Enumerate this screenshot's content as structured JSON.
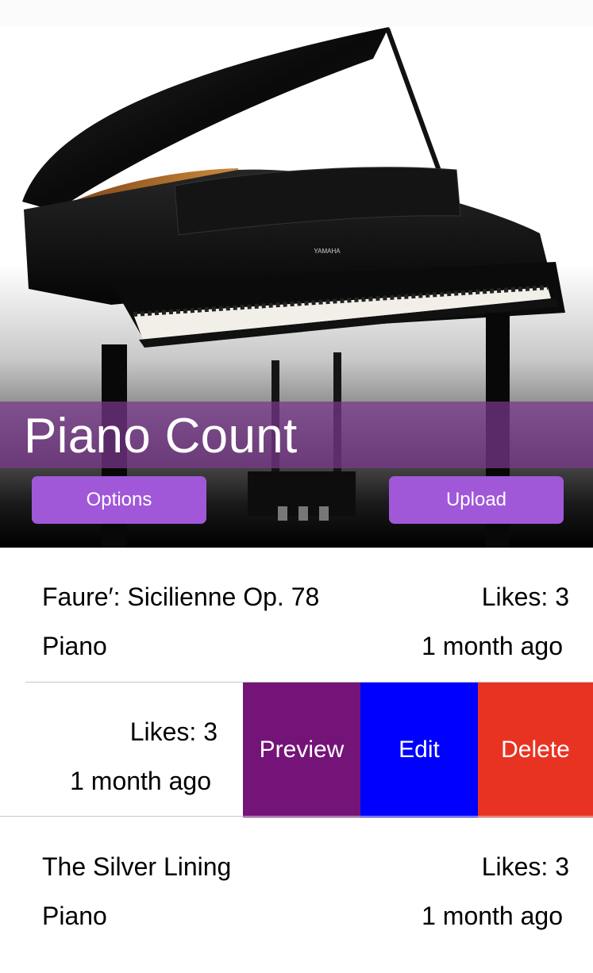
{
  "header": {
    "title": "Piano Count",
    "options_label": "Options",
    "upload_label": "Upload",
    "brand_on_piano": "YAMAHA"
  },
  "recordings": [
    {
      "title": "Faure′: Sicilienne Op. 78",
      "instrument": "Piano",
      "likes": "Likes: 3",
      "time": "1 month ago"
    },
    {
      "title": "",
      "instrument": "",
      "likes": "Likes: 3",
      "time": "1 month ago"
    },
    {
      "title": "The Silver Lining",
      "instrument": "Piano",
      "likes": "Likes: 3",
      "time": "1 month ago"
    }
  ],
  "swipe_actions": {
    "preview": "Preview",
    "edit": "Edit",
    "delete": "Delete"
  },
  "colors": {
    "button": "#a058d9",
    "title_band": "#7a368c",
    "preview": "#741478",
    "edit": "#0000ff",
    "delete": "#e93322"
  }
}
